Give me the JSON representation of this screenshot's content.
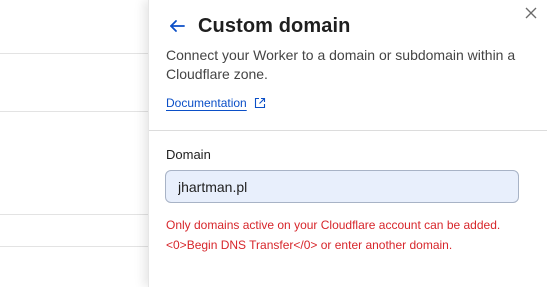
{
  "panel": {
    "title": "Custom domain",
    "description": "Connect your Worker to a domain or subdomain within a Cloudflare zone.",
    "documentation_link": "Documentation"
  },
  "domain_field": {
    "label": "Domain",
    "value": "jhartman.pl"
  },
  "error": {
    "message_line1": "Only domains active on your Cloudflare account can be added.",
    "message_line2": "<0>Begin DNS Transfer</0> or enter another domain."
  },
  "icons": {
    "back": "arrow-left-icon",
    "close": "close-icon",
    "external": "external-link-icon"
  },
  "colors": {
    "accent": "#0b4fc7",
    "error": "#d7262b",
    "input_bg": "#e8effc"
  }
}
